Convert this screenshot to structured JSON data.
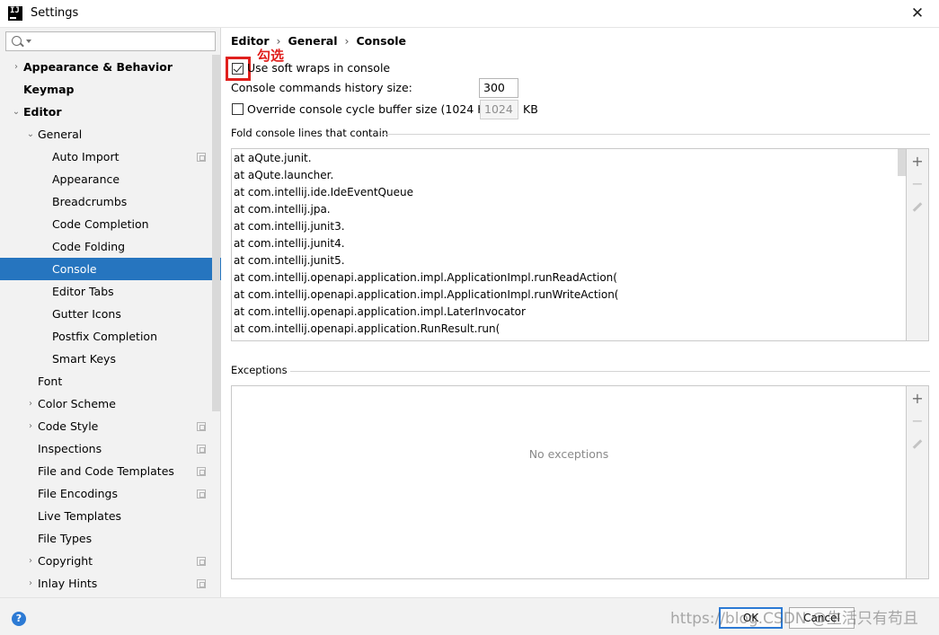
{
  "window": {
    "title": "Settings",
    "app_icon_text": "IJ"
  },
  "search": {
    "placeholder": ""
  },
  "sidebar": {
    "items": [
      {
        "label": "Appearance & Behavior",
        "bold": true,
        "arrow": "›",
        "level": 0
      },
      {
        "label": "Keymap",
        "bold": true,
        "arrow": "",
        "level": 0
      },
      {
        "label": "Editor",
        "bold": true,
        "arrow": "⌄",
        "level": 0
      },
      {
        "label": "General",
        "bold": false,
        "arrow": "⌄",
        "level": 1
      },
      {
        "label": "Auto Import",
        "level": 2,
        "copy": true
      },
      {
        "label": "Appearance",
        "level": 2
      },
      {
        "label": "Breadcrumbs",
        "level": 2
      },
      {
        "label": "Code Completion",
        "level": 2
      },
      {
        "label": "Code Folding",
        "level": 2
      },
      {
        "label": "Console",
        "level": 2,
        "selected": true
      },
      {
        "label": "Editor Tabs",
        "level": 2
      },
      {
        "label": "Gutter Icons",
        "level": 2
      },
      {
        "label": "Postfix Completion",
        "level": 2
      },
      {
        "label": "Smart Keys",
        "level": 2
      },
      {
        "label": "Font",
        "level": 1
      },
      {
        "label": "Color Scheme",
        "level": 1,
        "arrow": "›"
      },
      {
        "label": "Code Style",
        "level": 1,
        "arrow": "›",
        "copy": true
      },
      {
        "label": "Inspections",
        "level": 1,
        "copy": true
      },
      {
        "label": "File and Code Templates",
        "level": 1,
        "copy": true
      },
      {
        "label": "File Encodings",
        "level": 1,
        "copy": true
      },
      {
        "label": "Live Templates",
        "level": 1
      },
      {
        "label": "File Types",
        "level": 1
      },
      {
        "label": "Copyright",
        "level": 1,
        "arrow": "›",
        "copy": true
      },
      {
        "label": "Inlay Hints",
        "level": 1,
        "arrow": "›",
        "copy": true
      }
    ]
  },
  "breadcrumb": {
    "part1": "Editor",
    "part2": "General",
    "part3": "Console",
    "separator": "›"
  },
  "annotation": {
    "text": "勾选",
    "color": "#e0201d"
  },
  "options": {
    "soft_wraps_label": "Use soft wraps in console",
    "soft_wraps_checked": true,
    "history_label": "Console commands history size:",
    "history_value": "300",
    "override_label": "Override console cycle buffer size (1024 KB)",
    "override_checked": false,
    "override_value": "1024",
    "override_unit": "KB"
  },
  "fold_section": {
    "title": "Fold console lines that contain",
    "lines": [
      "at aQute.junit.",
      "at aQute.launcher.",
      "at com.intellij.ide.IdeEventQueue",
      "at com.intellij.jpa.",
      "at com.intellij.junit3.",
      "at com.intellij.junit4.",
      "at com.intellij.junit5.",
      "at com.intellij.openapi.application.impl.ApplicationImpl.runReadAction(",
      "at com.intellij.openapi.application.impl.ApplicationImpl.runWriteAction(",
      "at com.intellij.openapi.application.impl.LaterInvocator",
      "at com.intellij.openapi.application.RunResult.run("
    ]
  },
  "exceptions_section": {
    "title": "Exceptions",
    "empty_text": "No exceptions"
  },
  "toolbar": {
    "add": "+",
    "remove": "−"
  },
  "footer": {
    "help": "?",
    "ok": "OK",
    "cancel": "Cancel",
    "watermark": "https://blog.CSDN @生活只有苟且"
  },
  "colors": {
    "accent": "#2675bf",
    "selection": "#2675bf",
    "sidebar_bg": "#f2f2f2",
    "annotation": "#e0201d"
  }
}
